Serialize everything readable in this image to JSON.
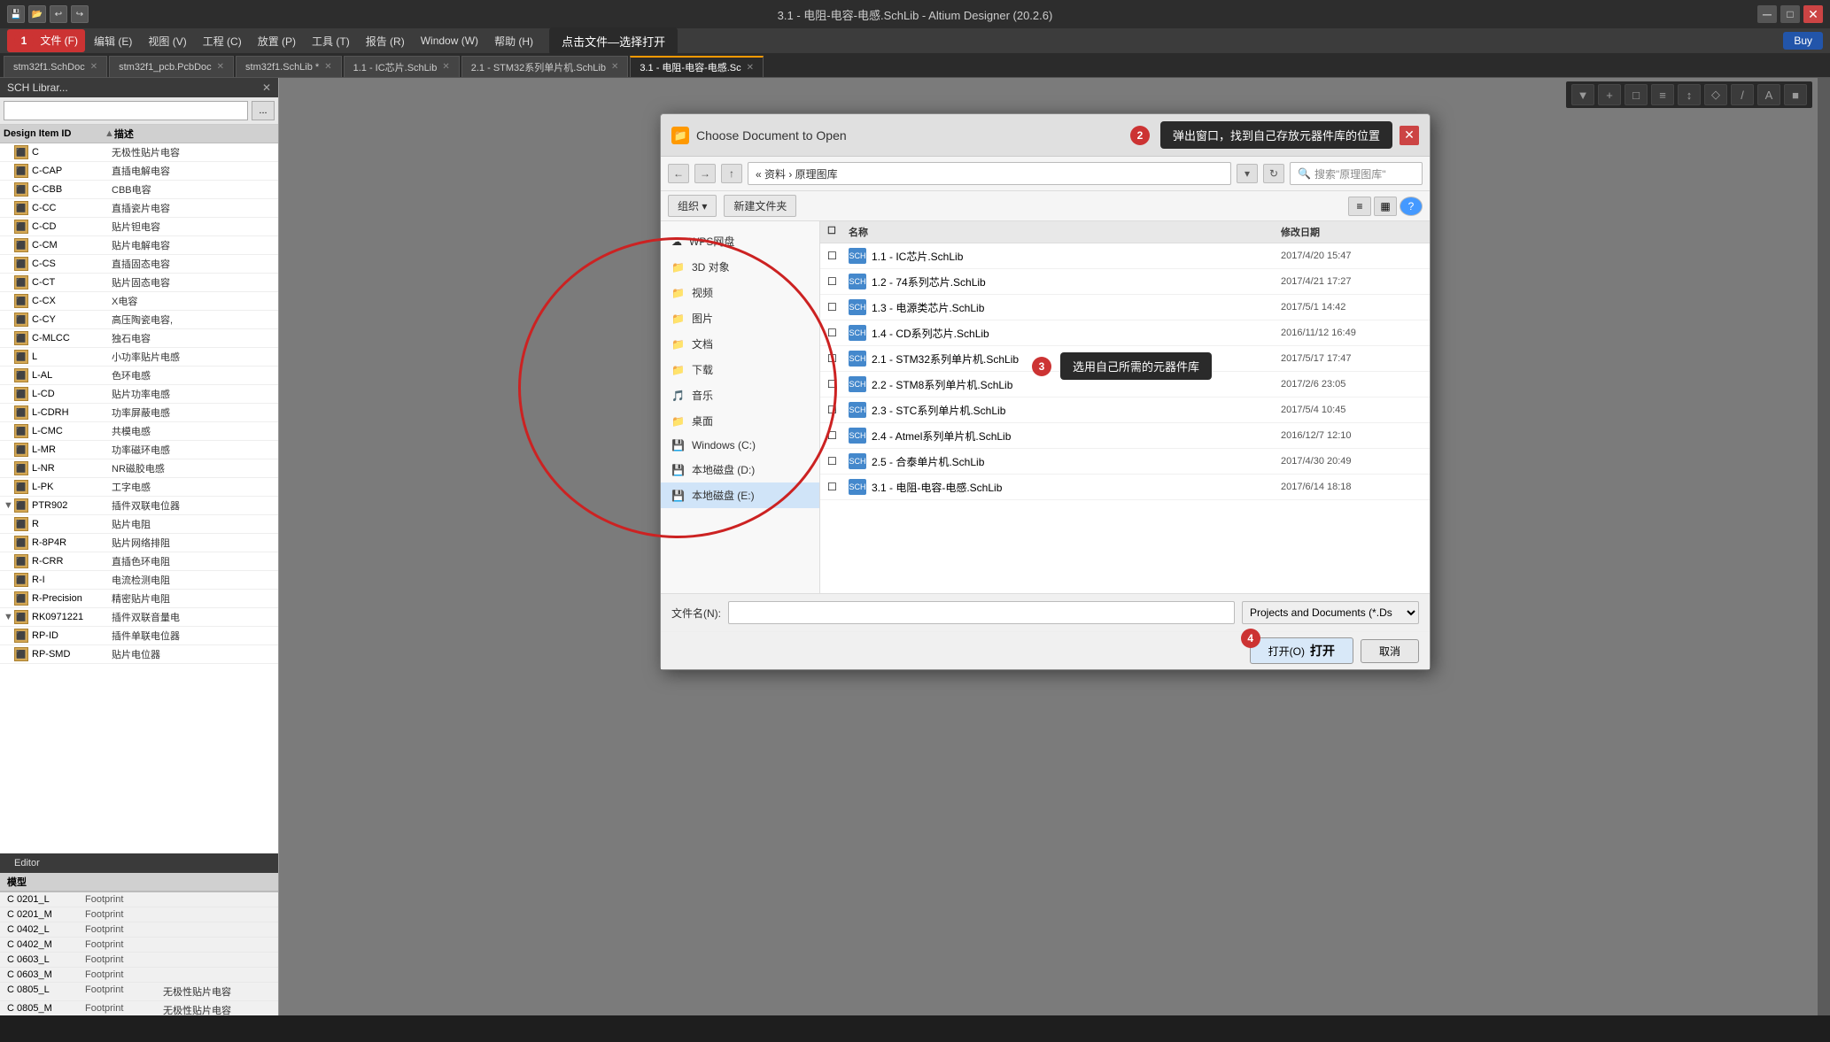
{
  "window": {
    "title": "3.1  - 电阻-电容-电感.SchLib - Altium Designer (20.2.6)"
  },
  "titlebar": {
    "text": "3.1  - 电阻-电容-电感.SchLib - Altium Designer (20.2.6)"
  },
  "menu": {
    "items": [
      "文件 (F)",
      "编辑 (E)",
      "视图 (V)",
      "工程 (C)",
      "放置 (P)",
      "工具 (T)",
      "报告 (R)",
      "Window (W)",
      "帮助 (H)"
    ],
    "annotation": "点击文件—选择打开",
    "badge": "1"
  },
  "tabs": [
    {
      "label": "stm32f1.SchDoc",
      "active": false
    },
    {
      "label": "stm32f1_pcb.PcbDoc",
      "active": false
    },
    {
      "label": "stm32f1.SchLib *",
      "active": false
    },
    {
      "label": "1.1  - IC芯片.SchLib",
      "active": false
    },
    {
      "label": "2.1  - STM32系列单片机.SchLib",
      "active": false
    },
    {
      "label": "3.1  - 电阻-电容-电感.Sc",
      "active": true
    }
  ],
  "left_panel": {
    "title": "SCH Librar...",
    "search_placeholder": "",
    "col_id": "Design Item ID",
    "col_desc": "描述",
    "items": [
      {
        "id": "C",
        "desc": "无极性贴片电容",
        "expand": false
      },
      {
        "id": "C-CAP",
        "desc": "直插电解电容",
        "expand": false
      },
      {
        "id": "C-CBB",
        "desc": "CBB电容",
        "expand": false
      },
      {
        "id": "C-CC",
        "desc": "直插瓷片电容",
        "expand": false
      },
      {
        "id": "C-CD",
        "desc": "贴片钽电容",
        "expand": false
      },
      {
        "id": "C-CM",
        "desc": "贴片电解电容",
        "expand": false
      },
      {
        "id": "C-CS",
        "desc": "直插固态电容",
        "expand": false
      },
      {
        "id": "C-CT",
        "desc": "贴片固态电容",
        "expand": false
      },
      {
        "id": "C-CX",
        "desc": "X电容",
        "expand": false
      },
      {
        "id": "C-CY",
        "desc": "高压陶瓷电容,",
        "expand": false
      },
      {
        "id": "C-MLCC",
        "desc": "独石电容",
        "expand": false
      },
      {
        "id": "L",
        "desc": "小功率贴片电感",
        "expand": false
      },
      {
        "id": "L-AL",
        "desc": "色环电感",
        "expand": false
      },
      {
        "id": "L-CD",
        "desc": "贴片功率电感",
        "expand": false
      },
      {
        "id": "L-CDRH",
        "desc": "功率屏蔽电感",
        "expand": false
      },
      {
        "id": "L-CMC",
        "desc": "共模电感",
        "expand": false
      },
      {
        "id": "L-MR",
        "desc": "功率磁环电感",
        "expand": false
      },
      {
        "id": "L-NR",
        "desc": "NR磁胶电感",
        "expand": false
      },
      {
        "id": "L-PK",
        "desc": "工字电感",
        "expand": false
      },
      {
        "id": "PTR902",
        "desc": "插件双联电位器",
        "expand": true
      },
      {
        "id": "R",
        "desc": "贴片电阻",
        "expand": false
      },
      {
        "id": "R-8P4R",
        "desc": "贴片网络排阻",
        "expand": false
      },
      {
        "id": "R-CRR",
        "desc": "直插色环电阻",
        "expand": false
      },
      {
        "id": "R-I",
        "desc": "电流检测电阻",
        "expand": false
      },
      {
        "id": "R-Precision",
        "desc": "精密贴片电阻",
        "expand": false
      },
      {
        "id": "RK0971221",
        "desc": "插件双联音量电",
        "expand": true
      },
      {
        "id": "RP-ID",
        "desc": "插件单联电位器",
        "expand": false
      },
      {
        "id": "RP-SMD",
        "desc": "贴片电位器",
        "expand": false
      }
    ]
  },
  "bottom_section": {
    "editor_label": "Editor",
    "models_header": "模型",
    "models": [
      {
        "name": "C 0201_L",
        "type": "Footprint",
        "desc": ""
      },
      {
        "name": "C 0201_M",
        "type": "Footprint",
        "desc": ""
      },
      {
        "name": "C 0402_L",
        "type": "Footprint",
        "desc": ""
      },
      {
        "name": "C 0402_M",
        "type": "Footprint",
        "desc": ""
      },
      {
        "name": "C 0603_L",
        "type": "Footprint",
        "desc": ""
      },
      {
        "name": "C 0603_M",
        "type": "Footprint",
        "desc": ""
      },
      {
        "name": "C 0805_L",
        "type": "Footprint",
        "desc": "无极性贴片电容"
      },
      {
        "name": "C 0805_M",
        "type": "Footprint",
        "desc": "无极性贴片电容"
      }
    ]
  },
  "dialog": {
    "title": "Choose Document to Open",
    "annotation": "弹出窗口，找到自己存放元器件库的位置",
    "badge": "2",
    "nav": {
      "back": "←",
      "forward": "→",
      "up": "↑",
      "path": "« 资料 › 原理图库",
      "refresh": "↻",
      "search_placeholder": "搜索\"原理图库\""
    },
    "toolbar": {
      "organize": "组织 ▾",
      "new_folder": "新建文件夹"
    },
    "left_items": [
      {
        "label": "WPS网盘",
        "type": "cloud"
      },
      {
        "label": "3D 对象",
        "type": "folder"
      },
      {
        "label": "视频",
        "type": "folder"
      },
      {
        "label": "图片",
        "type": "folder"
      },
      {
        "label": "文档",
        "type": "folder"
      },
      {
        "label": "下载",
        "type": "folder"
      },
      {
        "label": "音乐",
        "type": "music"
      },
      {
        "label": "桌面",
        "type": "folder"
      },
      {
        "label": "Windows (C:)",
        "type": "drive"
      },
      {
        "label": "本地磁盘 (D:)",
        "type": "drive"
      },
      {
        "label": "本地磁盘 (E:)",
        "type": "drive",
        "selected": true
      }
    ],
    "files": [
      {
        "name": "1.1  - IC芯片.SchLib",
        "date": "2017/4/20 15:47"
      },
      {
        "name": "1.2  - 74系列芯片.SchLib",
        "date": "2017/4/21 17:27"
      },
      {
        "name": "1.3  - 电源类芯片.SchLib",
        "date": "2017/5/1 14:42"
      },
      {
        "name": "1.4  - CD系列芯片.SchLib",
        "date": "2016/11/12 16:49"
      },
      {
        "name": "2.1  - STM32系列单片机.SchLib",
        "date": "2017/5/17 17:47"
      },
      {
        "name": "2.2  - STM8系列单片机.SchLib",
        "date": "2017/2/6 23:05"
      },
      {
        "name": "2.3  - STC系列单片机.SchLib",
        "date": "2017/5/4 10:45"
      },
      {
        "name": "2.4  - Atmel系列单片机.SchLib",
        "date": "2016/12/7 12:10"
      },
      {
        "name": "2.5  - 合泰单片机.SchLib",
        "date": "2017/4/30 20:49"
      },
      {
        "name": "3.1  - 电阻-电容-电感.SchLib",
        "date": "2017/6/14 18:18"
      }
    ],
    "file_header": {
      "name": "名称",
      "date": "修改日期"
    },
    "footer": {
      "filename_label": "文件名(N):",
      "filename_placeholder": "",
      "filetype_label": "Projects and Documents (*.Ds",
      "open_btn": "打开(O)",
      "cancel_btn": "取消"
    },
    "select_annotation": "选用自己所需的元器件库",
    "select_badge": "3",
    "open_annotation": "打开",
    "open_badge": "4"
  },
  "colors": {
    "accent": "#ff9900",
    "badge_red": "#cc3333",
    "primary_blue": "#4488cc",
    "dialog_bg": "#f0f0f0"
  }
}
